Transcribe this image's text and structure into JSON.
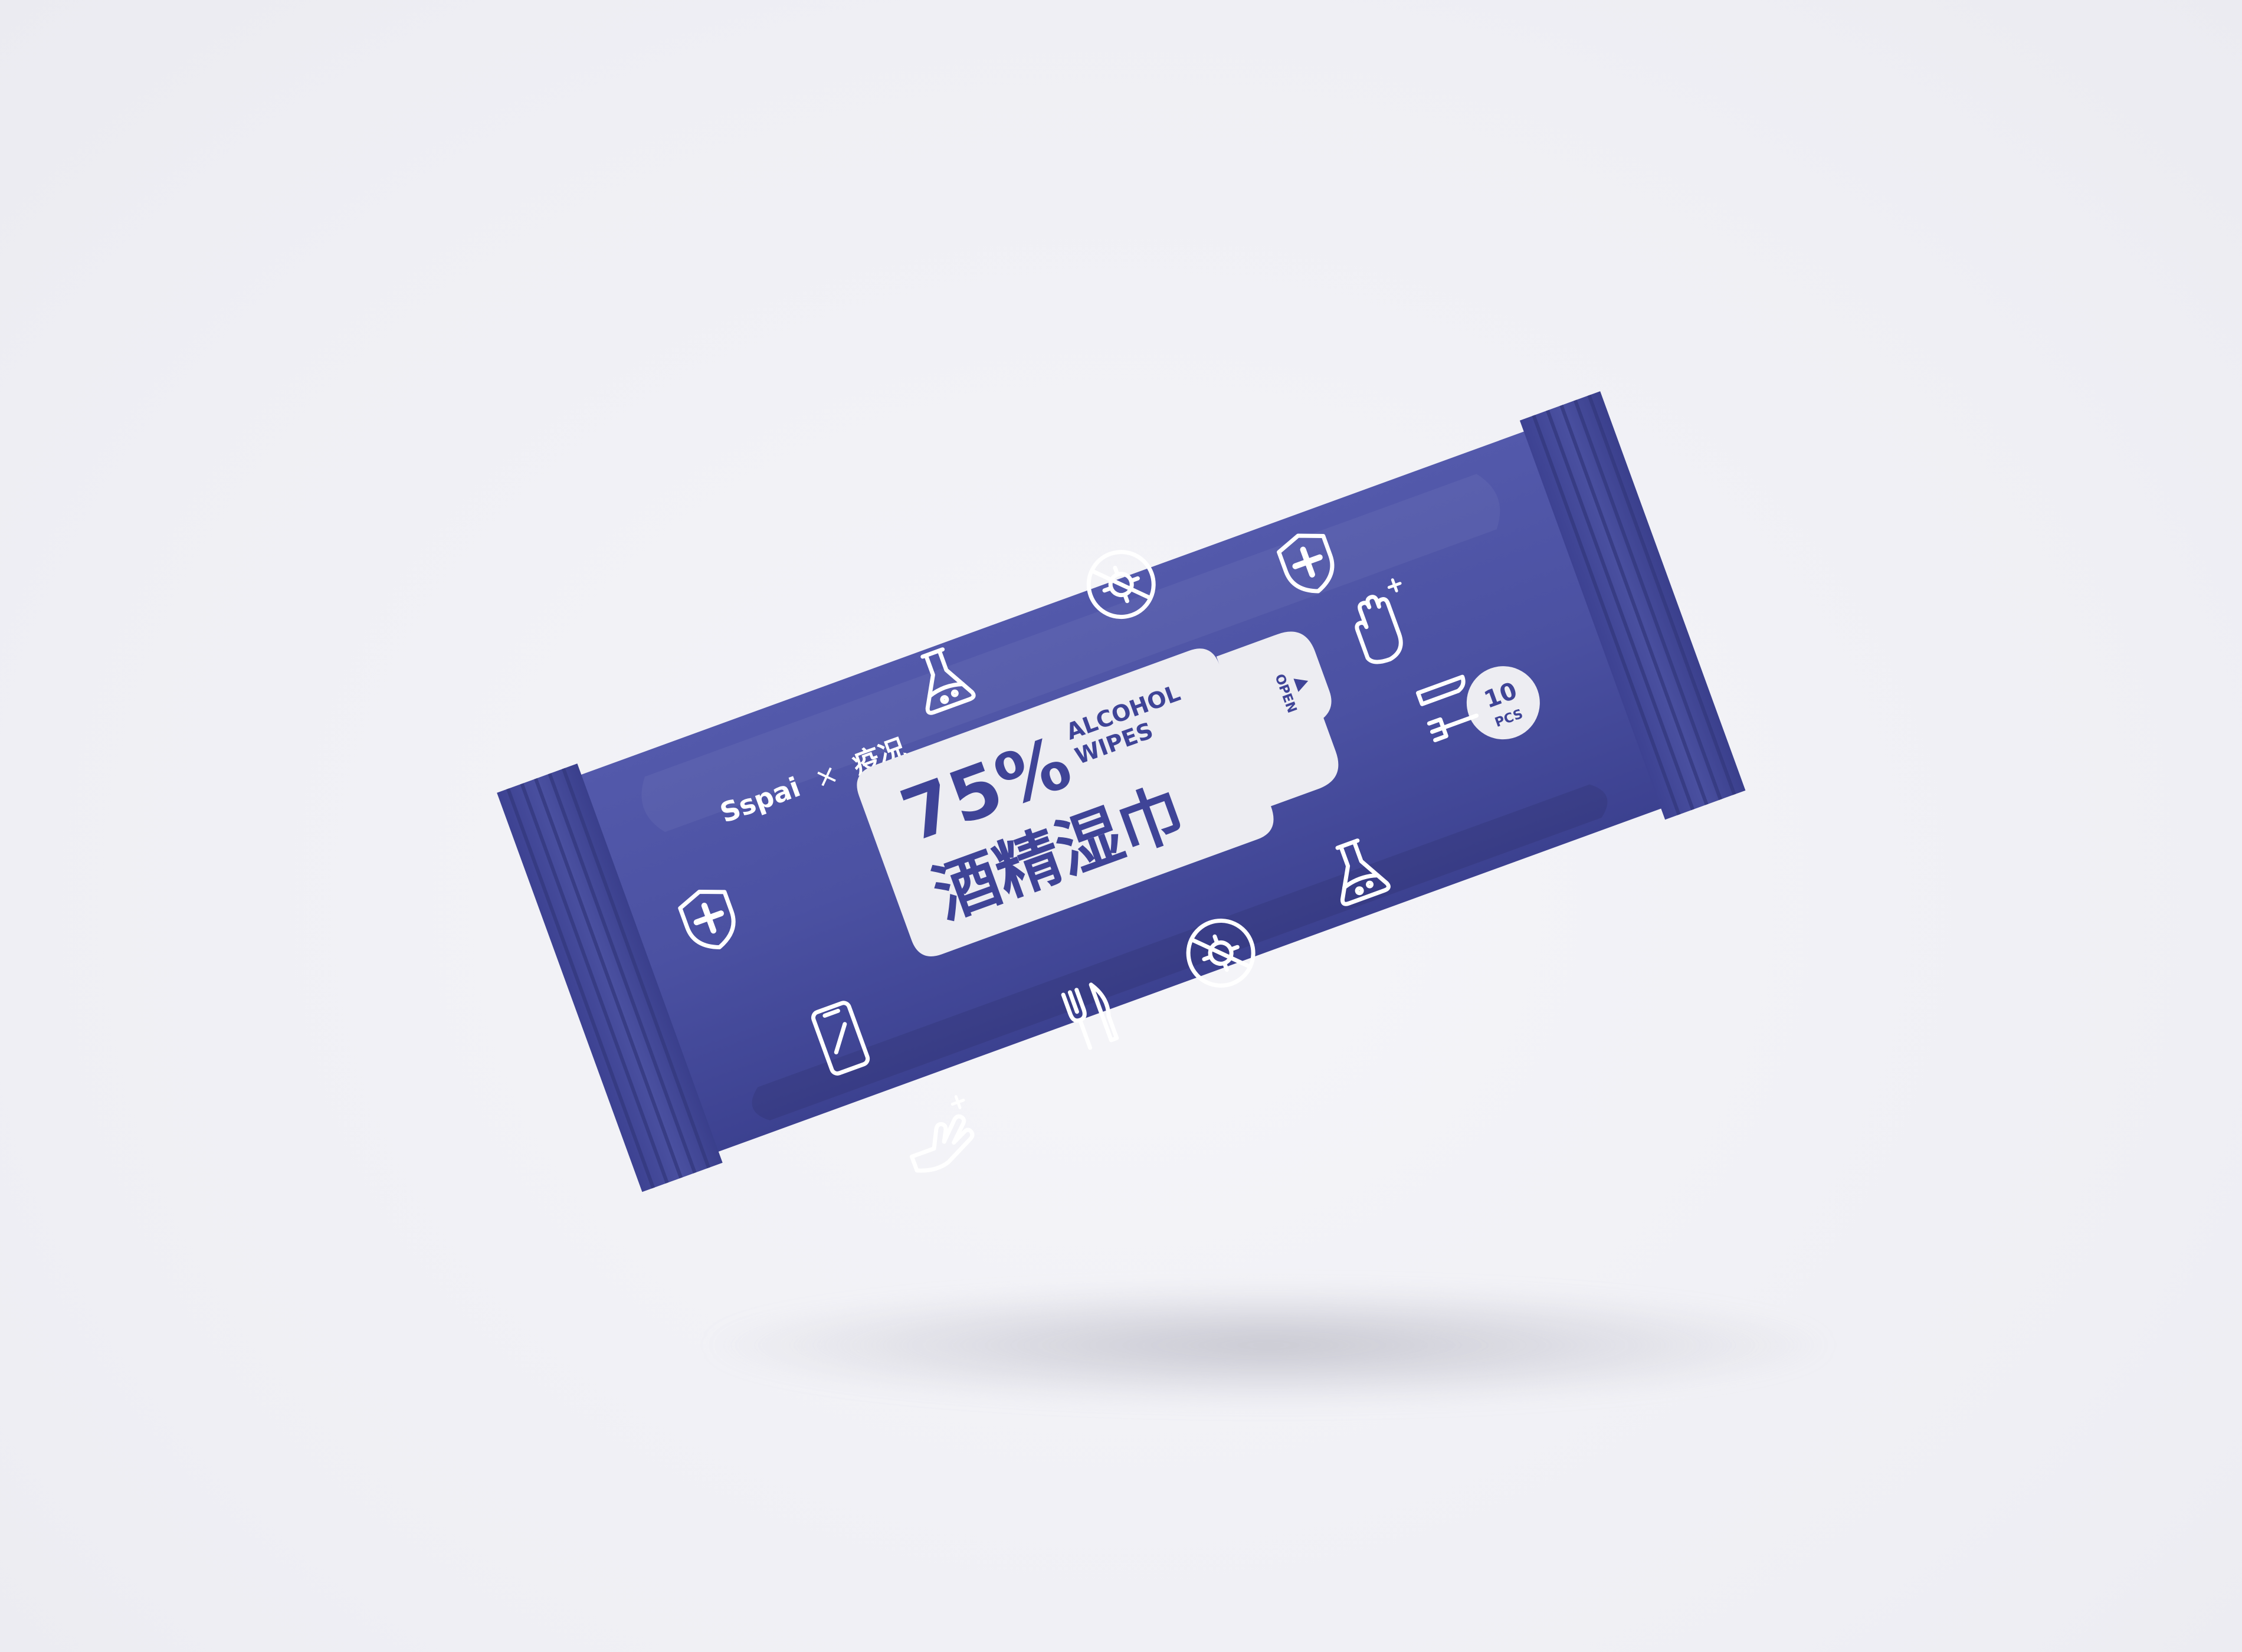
{
  "product": {
    "brand": "Sspai",
    "collab_symbol": "×",
    "collab_partner": "疫况",
    "percentage": "75%",
    "label_en_line1": "ALCOHOL",
    "label_en_line2": "WIPES",
    "label_cn": "酒精湿巾",
    "open_text": "OPEN",
    "count_number": "10",
    "count_unit": "PCS"
  },
  "icons": [
    "shield-cross-icon",
    "flask-icon",
    "no-virus-icon",
    "hand-sparkle-icon",
    "cutlery-icon",
    "smartphone-icon"
  ],
  "colors": {
    "background": "#f1f1f6",
    "package": "#4a4fa0",
    "package_dark": "#3a3f8a",
    "label": "#ededf2",
    "text_on_label": "#3f4497",
    "icon_stroke": "#ffffff"
  }
}
